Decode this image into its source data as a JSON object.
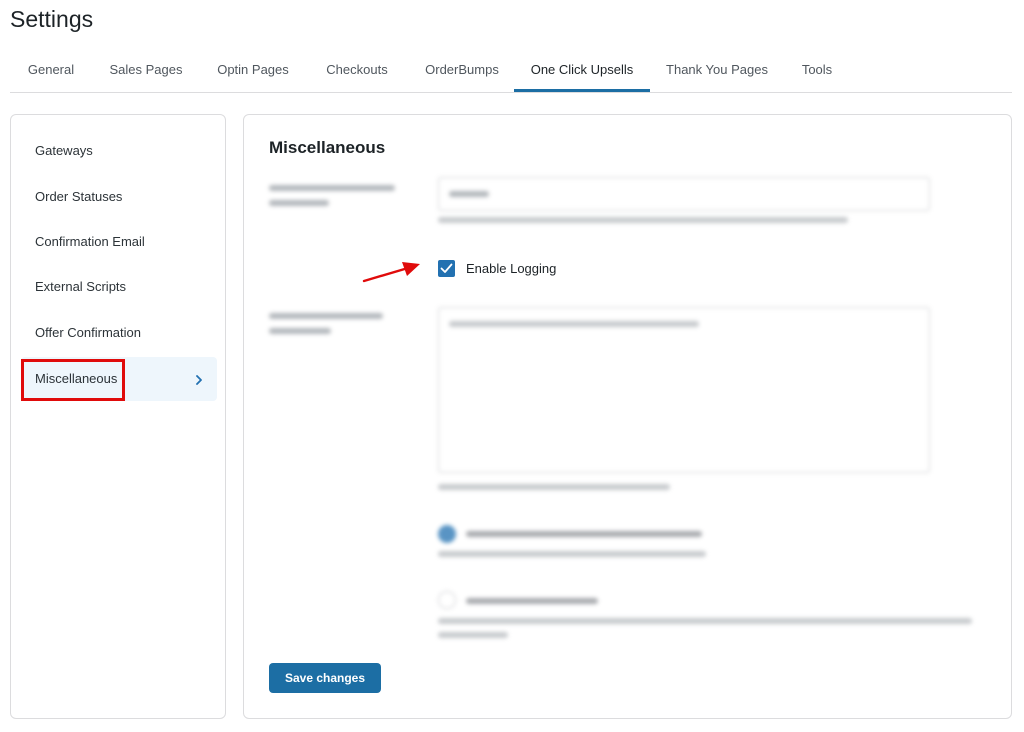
{
  "header": {
    "title": "Settings"
  },
  "tabs": [
    {
      "label": "General"
    },
    {
      "label": "Sales Pages"
    },
    {
      "label": "Optin Pages"
    },
    {
      "label": "Checkouts"
    },
    {
      "label": "OrderBumps"
    },
    {
      "label": "One Click Upsells",
      "active": true
    },
    {
      "label": "Thank You Pages"
    },
    {
      "label": "Tools"
    }
  ],
  "sidebar": {
    "items": [
      {
        "label": "Gateways"
      },
      {
        "label": "Order Statuses"
      },
      {
        "label": "Confirmation Email"
      },
      {
        "label": "External Scripts"
      },
      {
        "label": "Offer Confirmation"
      },
      {
        "label": "Miscellaneous",
        "active": true
      }
    ],
    "chevron": "chevron-right-icon"
  },
  "main": {
    "section_title": "Miscellaneous",
    "logging": {
      "label": "Enable Logging",
      "checked": true
    },
    "save_label": "Save changes"
  },
  "colors": {
    "accent": "#2271b1",
    "button": "#1c6ea4",
    "annotation": "#e00b0b"
  }
}
